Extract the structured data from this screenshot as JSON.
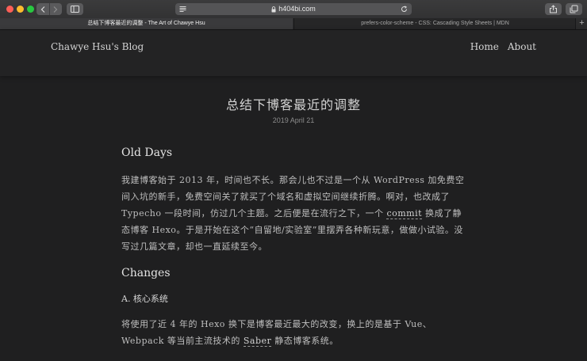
{
  "browser": {
    "address": "h404bi.com",
    "tabs": [
      {
        "label": "总结下博客最近的调整 - The Art of Chawye Hsu",
        "active": true
      },
      {
        "label": "prefers-color-scheme - CSS: Cascading Style Sheets | MDN",
        "active": false
      }
    ],
    "icons": {
      "back": "chevron-left-icon",
      "forward": "chevron-right-icon",
      "sidebar": "sidebar-icon",
      "reader": "reader-icon",
      "lock": "lock-icon",
      "reload": "reload-icon",
      "share": "share-icon",
      "tabs": "tabs-icon",
      "new_tab": "plus-icon"
    },
    "new_tab_glyph": "+"
  },
  "site": {
    "brand": "Chawye Hsu's Blog",
    "nav": [
      "Home",
      "About"
    ]
  },
  "post": {
    "title": "总结下博客最近的调整",
    "date": "2019 April 21",
    "sections": {
      "old_days": {
        "heading": "Old Days",
        "paragraph": {
          "before_link": "我建博客始于 2013 年，时间也不长。那会儿也不过是一个从 WordPress 加免费空间入坑的新手，免费空间关了就买了个域名和虚拟空间继续折腾。啊对，也改成了 Typecho 一段时间，仿过几个主题。之后便是在流行之下，一个 ",
          "link": "commit",
          "after_link": " 换成了静态博客 Hexo。于是开始在这个“自留地/实验室”里摆弄各种新玩意，做做小试验。没写过几篇文章，却也一直延续至今。"
        }
      },
      "changes": {
        "heading": "Changes",
        "subheading": "A. 核心系统",
        "paragraph": {
          "before_link": "将使用了近 4 年的 Hexo 换下是博客最近最大的改变，换上的是基于 Vue、Webpack 等当前主流技术的 ",
          "link": "Saber",
          "after_link": " 静态博客系统。"
        }
      }
    }
  },
  "colors": {
    "page_background": "#1f1f20",
    "header_background": "#232324",
    "text": "#bfbfbf",
    "heading": "#e4e4e4",
    "traffic_red": "#fd5f57",
    "traffic_yellow": "#fdbc2e",
    "traffic_green": "#28c840"
  }
}
